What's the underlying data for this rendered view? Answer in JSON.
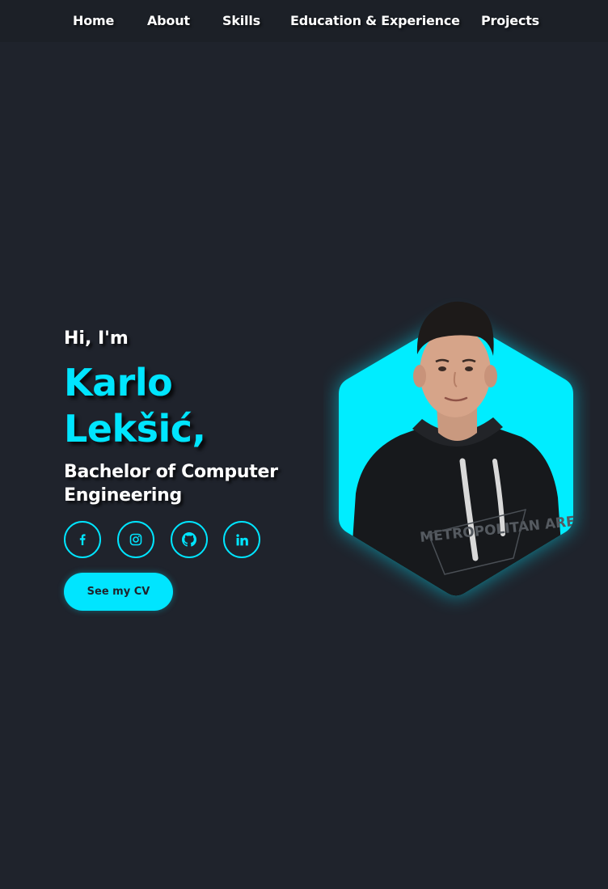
{
  "nav": {
    "items": [
      {
        "label": "Home"
      },
      {
        "label": "About"
      },
      {
        "label": "Skills"
      },
      {
        "label": "Education & Experience"
      },
      {
        "label": "Projects"
      }
    ]
  },
  "hero": {
    "greeting": "Hi, I'm",
    "name_first": "Karlo",
    "name_last": "Lekšić,",
    "title_line1": "Bachelor of Computer",
    "title_line2": "Engineering",
    "cv_button": "See my CV",
    "hoodie_print": "METROPOLITAN AREA",
    "social": [
      {
        "icon": "facebook-icon"
      },
      {
        "icon": "instagram-icon"
      },
      {
        "icon": "github-icon"
      },
      {
        "icon": "linkedin-icon"
      }
    ]
  },
  "colors": {
    "background": "#1f232c",
    "navbar": "#1c2027",
    "accent": "#00e5ff",
    "text": "#ffffff"
  }
}
